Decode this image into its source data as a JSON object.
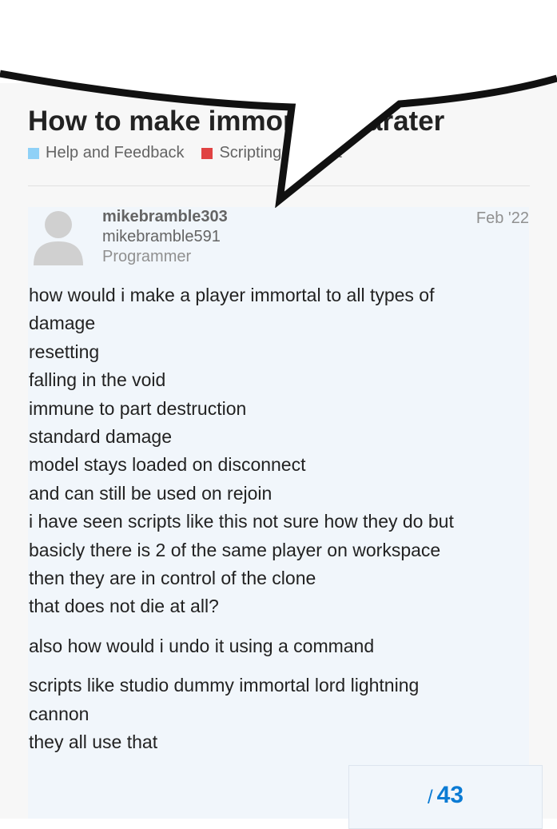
{
  "topic": {
    "title": "How to make immortal charater",
    "categories": [
      {
        "label": "Help and Feedback",
        "color": "#8fd1f7"
      },
      {
        "label": "Scripting Support",
        "color": "#e04343"
      }
    ]
  },
  "post": {
    "username": "mikebramble303",
    "display_name": "mikebramble591",
    "user_title": "Programmer",
    "date": "Feb '22",
    "paragraphs": [
      [
        "how would i make a player immortal to all types of",
        "damage",
        "resetting",
        "falling in the void",
        "immune to part destruction",
        "standard damage",
        "model stays loaded on disconnect",
        "and can still be used on rejoin",
        "i have seen scripts like this not sure how they do but",
        "basicly there is 2 of the same player on workspace",
        "then they are in control of the clone",
        "that does not die at all?"
      ],
      [
        "also how would i undo it using a command"
      ],
      [
        "scripts like studio dummy immortal lord lightning",
        "cannon",
        "they all use that"
      ]
    ]
  },
  "timeline": {
    "separator": "/",
    "total": "43"
  },
  "colors": {
    "accent": "#0a7bd4",
    "post_background": "#f1f6fb"
  },
  "icons": {
    "avatar": "default-avatar-icon"
  }
}
